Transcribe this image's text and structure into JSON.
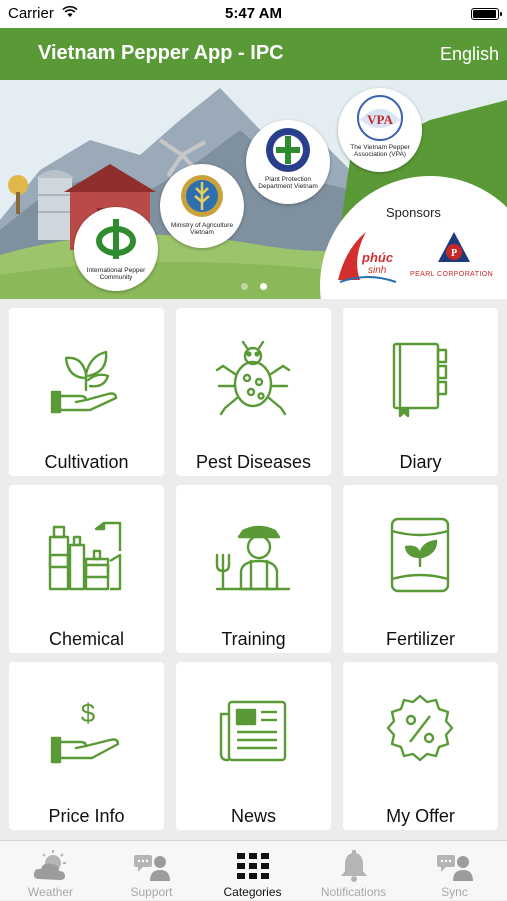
{
  "status_bar": {
    "carrier": "Carrier",
    "time": "5:47 AM",
    "battery_level": 1.0
  },
  "header": {
    "title": "Vietnam Pepper App - IPC",
    "language": "English"
  },
  "banner": {
    "logos": [
      {
        "name": "International Pepper Community"
      },
      {
        "name": "Ministry of Agriculture Vietnam"
      },
      {
        "name": "Plant Protection Department Vietnam"
      },
      {
        "name": "The Vietnam Pepper Association (VPA)",
        "mark": "VPA"
      }
    ],
    "sponsors_label": "Sponsors",
    "sponsors": [
      {
        "name": "phúc sinh"
      },
      {
        "name": "PEARL CORPORATION"
      }
    ],
    "page_dots": {
      "count": 2,
      "active_index": 1
    }
  },
  "categories": [
    {
      "label": "Cultivation",
      "icon": "hand-plant-icon"
    },
    {
      "label": "Pest Diseases",
      "icon": "bug-icon"
    },
    {
      "label": "Diary",
      "icon": "notebook-icon"
    },
    {
      "label": "Chemical",
      "icon": "chemical-bottles-icon"
    },
    {
      "label": "Training",
      "icon": "farmer-icon"
    },
    {
      "label": "Fertilizer",
      "icon": "fertilizer-bag-icon"
    },
    {
      "label": "Price Info",
      "icon": "hand-dollar-icon"
    },
    {
      "label": "News",
      "icon": "newspaper-icon"
    },
    {
      "label": "My Offer",
      "icon": "percent-badge-icon"
    }
  ],
  "tab_bar": [
    {
      "label": "Weather",
      "icon": "weather-icon",
      "active": false
    },
    {
      "label": "Support",
      "icon": "support-icon",
      "active": false
    },
    {
      "label": "Categories",
      "icon": "grid-icon",
      "active": true
    },
    {
      "label": "Notifications",
      "icon": "bell-icon",
      "active": false
    },
    {
      "label": "Sync",
      "icon": "sync-icon",
      "active": false
    }
  ],
  "colors": {
    "brand_green": "#5a9a36",
    "icon_green": "#5a9a36",
    "background": "#ececec",
    "inactive_tab": "#a8a8a8"
  }
}
